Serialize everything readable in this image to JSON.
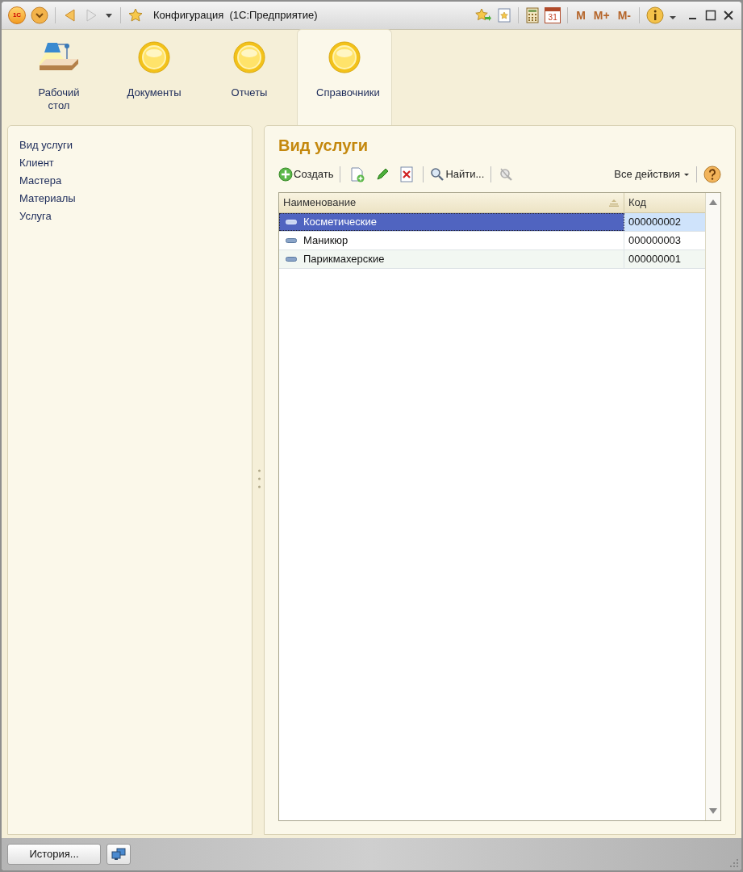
{
  "window": {
    "title": "Конфигурация  (1С:Предприятие)",
    "logo": "1С",
    "calendar_day": "31",
    "memory_buttons": [
      "M",
      "M+",
      "M-"
    ]
  },
  "sections": [
    {
      "label": "Рабочий стол",
      "kind": "desktop",
      "selected": false
    },
    {
      "label": "Документы",
      "kind": "section",
      "selected": false
    },
    {
      "label": "Отчеты",
      "kind": "section",
      "selected": false
    },
    {
      "label": "Справочники",
      "kind": "section",
      "selected": true
    }
  ],
  "sidebar": {
    "items": [
      "Вид услуги",
      "Клиент",
      "Мастера",
      "Материалы",
      "Услуга"
    ]
  },
  "form": {
    "title": "Вид услуги",
    "toolbar": {
      "create": "Создать",
      "find": "Найти...",
      "all_actions": "Все действия"
    },
    "table": {
      "columns": [
        "Наименование",
        "Код"
      ],
      "rows": [
        {
          "name": "Косметические",
          "code": "000000002",
          "selected": true
        },
        {
          "name": "Маникюр",
          "code": "000000003",
          "selected": false
        },
        {
          "name": "Парикмахерские",
          "code": "000000001",
          "selected": false
        }
      ]
    }
  },
  "status_bar": {
    "history": "История..."
  }
}
